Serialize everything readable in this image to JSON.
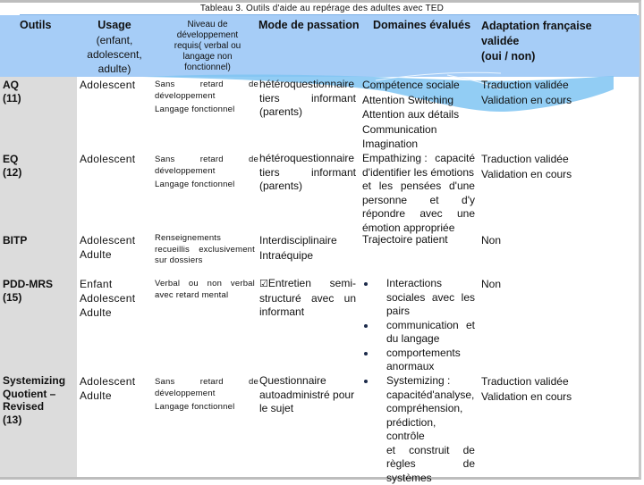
{
  "caption": "Tableau 3. Outils d'aide au repérage des adultes avec TED",
  "colors": {
    "header_bg": "#a6cdf7",
    "tool_col_bg": "#dcdcdc",
    "wave": "#7fc4f2"
  },
  "headers": {
    "outils": "Outils",
    "usage_title": "Usage",
    "usage_l1": "(enfant,",
    "usage_l2": "adolescent,",
    "usage_l3": "adulte)",
    "niveau_l1": "Niveau de",
    "niveau_l2": "développement",
    "niveau_l3": "requis( verbal ou",
    "niveau_l4": "langage non",
    "niveau_l5": "fonctionnel)",
    "mode": "Mode de passation",
    "domaines": "Domaines évalués",
    "adapt_l1": "Adaptation française",
    "adapt_l2": "validée",
    "adapt_l3": "(oui / non)"
  },
  "rows": [
    {
      "tool_l1": "AQ",
      "tool_l2": "(11)",
      "usage": [
        "Adolescent"
      ],
      "niveau": {
        "a": "Sans",
        "b": "retard",
        "c": "de",
        "l2": "développement",
        "l3": "Langage fonctionnel"
      },
      "mode": {
        "l1": "hétéroquestionnaire",
        "l2a": "tiers",
        "l2b": "informant",
        "l3": "(parents)"
      },
      "domaines": [
        "Compétence sociale",
        "Attention Switching",
        "Attention aux détails",
        "Communication",
        "Imagination"
      ],
      "adapt": [
        "Traduction validée",
        "Validation en cours"
      ]
    },
    {
      "tool_l1": "EQ",
      "tool_l2": "(12)",
      "usage": [
        "Adolescent"
      ],
      "niveau": {
        "a": "Sans",
        "b": "retard",
        "c": "de",
        "l2": "développement",
        "l3": "Langage fonctionnel"
      },
      "mode": {
        "l1": "hétéroquestionnaire",
        "l2a": "tiers",
        "l2b": "informant",
        "l3": "(parents)"
      },
      "domaines": [
        "Empathizing :",
        "capacité",
        "d'identifier les émotions",
        "et",
        "les",
        "pensées",
        "d'une",
        "personne",
        "et",
        "d'y",
        "répondre",
        "avec",
        "une",
        "émotion appropriée"
      ],
      "adapt": [
        "Traduction validée",
        "Validation en cours"
      ]
    },
    {
      "tool_l1": "BITP",
      "usage": [
        "Adolescent",
        "Adulte"
      ],
      "niveau": {
        "l1": "Renseignements",
        "l2a": "recueillis",
        "l2b": "exclusivement",
        "l3": "sur dossiers"
      },
      "mode": {
        "l1": "Interdisciplinaire",
        "l2": "Intraéquipe"
      },
      "domaines": [
        "Trajectoire patient"
      ],
      "adapt": [
        "Non"
      ]
    },
    {
      "tool_l1": "PDD-MRS",
      "tool_l2": "(15)",
      "usage": [
        "Enfant",
        "Adolescent",
        "Adulte"
      ],
      "niveau": {
        "a": "Verbal",
        "b": "ou",
        "c": "non",
        "d": "verbal",
        "l2": "avec retard mental"
      },
      "mode": {
        "icon": "checkbox-icon",
        "l1a": "Entretien",
        "l1b": "semi-",
        "l2a": "structuré",
        "l2b": "avec",
        "l2c": "un",
        "l3": "informant"
      },
      "domaines": {
        "bullets": [
          {
            "l1a": "Interactions",
            "l2a": "sociales",
            "l2b": "avec",
            "l2c": "les",
            "l3": "pairs"
          },
          {
            "l1a": "communication",
            "l1b": "et",
            "l2": "du langage"
          },
          {
            "l1": "comportements",
            "l2": "anormaux"
          }
        ]
      },
      "adapt": [
        "Non"
      ]
    },
    {
      "tool_l1": "Systemizing",
      "tool_l2": "Quotient –",
      "tool_l3": "Revised",
      "tool_l4": "(13)",
      "usage": [
        "Adolescent",
        "Adulte"
      ],
      "niveau": {
        "a": "Sans",
        "b": "retard",
        "c": "de",
        "l2": "développement",
        "l3": "Langage fonctionnel"
      },
      "mode": {
        "l1": "Questionnaire",
        "l2": "autoadministré pour",
        "l3": "le sujet"
      },
      "domaines": {
        "l1": "Systemizing :",
        "l2": "capacitéd'analyse,",
        "l3": "compréhension,",
        "l4": "prédiction, contrôle",
        "l5a": "et",
        "l5b": "construit",
        "l5c": "de",
        "l6a": "règles",
        "l6b": "de",
        "l7": "systèmes"
      },
      "adapt": [
        "Traduction validée",
        "Validation en cours"
      ]
    }
  ]
}
